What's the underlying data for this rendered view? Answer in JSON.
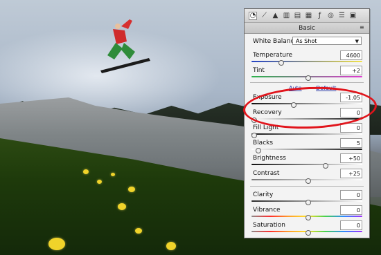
{
  "panel": {
    "title": "Basic",
    "white_balance": {
      "label": "White Balance:",
      "value": "As Shot"
    },
    "auto_link": "Auto",
    "default_link": "Default",
    "controls": [
      {
        "key": "temperature",
        "label": "Temperature",
        "value": "4600"
      },
      {
        "key": "tint",
        "label": "Tint",
        "value": "+2"
      },
      {
        "key": "exposure",
        "label": "Exposure",
        "value": "-1.05"
      },
      {
        "key": "recovery",
        "label": "Recovery",
        "value": "0"
      },
      {
        "key": "fill_light",
        "label": "Fill Light",
        "value": "0"
      },
      {
        "key": "blacks",
        "label": "Blacks",
        "value": "5"
      },
      {
        "key": "brightness",
        "label": "Brightness",
        "value": "+50"
      },
      {
        "key": "contrast",
        "label": "Contrast",
        "value": "+25"
      },
      {
        "key": "clarity",
        "label": "Clarity",
        "value": "0"
      },
      {
        "key": "vibrance",
        "label": "Vibrance",
        "value": "0"
      },
      {
        "key": "saturation",
        "label": "Saturation",
        "value": "0"
      }
    ]
  },
  "icons": {
    "toolbar": [
      "histogram-icon",
      "tone-curve-icon",
      "detail-icon",
      "hsl-icon",
      "split-toning-icon",
      "lens-icon",
      "fx-icon",
      "camera-calibration-icon",
      "presets-icon",
      "snapshots-icon"
    ],
    "panel_menu": "panel-menu-icon",
    "dropdown": "chevron-down-icon"
  },
  "colors": {
    "highlight": "#e1141b",
    "panel_bg": "#f3f3f3"
  }
}
